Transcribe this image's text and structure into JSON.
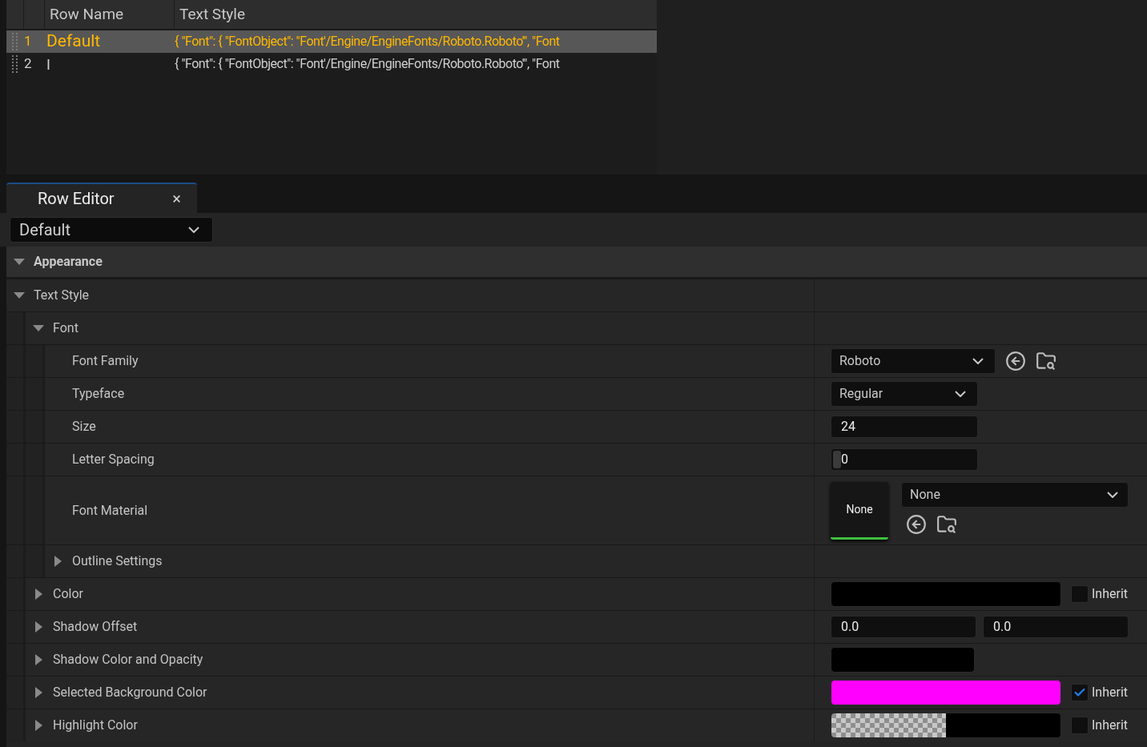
{
  "table": {
    "columns": [
      "Row Name",
      "Text Style"
    ],
    "rows": [
      {
        "index": "1",
        "name": "Default",
        "value": "{ \"Font\": { \"FontObject\": \"Font'/Engine/EngineFonts/Roboto.Roboto'\", \"Font",
        "selected": true
      },
      {
        "index": "2",
        "name": "I",
        "value": "{ \"Font\": { \"FontObject\": \"Font'/Engine/EngineFonts/Roboto.Roboto'\", \"Font",
        "selected": false
      }
    ]
  },
  "tab": {
    "label": "Row Editor",
    "close": "×"
  },
  "row_selector": {
    "value": "Default"
  },
  "category": {
    "label": "Appearance",
    "expanded": true
  },
  "properties": [
    {
      "label": "Text Style",
      "expanded": true,
      "children": [
        {
          "label": "Font",
          "expanded": true,
          "children": [
            {
              "label": "Font Family",
              "kind": "combo_browse",
              "value": "Roboto"
            },
            {
              "label": "Typeface",
              "kind": "combo",
              "value": "Regular"
            },
            {
              "label": "Size",
              "kind": "number",
              "value": "24"
            },
            {
              "label": "Letter Spacing",
              "kind": "number",
              "value": "0",
              "level": 0
            },
            {
              "label": "Font Material",
              "kind": "asset",
              "thumbnail": "None",
              "value": "None"
            },
            {
              "label": "Outline Settings",
              "expanded": false
            }
          ]
        },
        {
          "label": "Color",
          "kind": "color",
          "expanded": false,
          "color": "#000000",
          "inherit": {
            "label": "Inherit",
            "checked": false
          }
        },
        {
          "label": "Shadow Offset",
          "kind": "vector",
          "expanded": false,
          "values": [
            "0.0",
            "0.0"
          ]
        },
        {
          "label": "Shadow Color and Opacity",
          "kind": "color",
          "expanded": false,
          "color": "#000000"
        },
        {
          "label": "Selected Background Color",
          "kind": "color",
          "expanded": false,
          "color": "#ff00ff",
          "inherit": {
            "label": "Inherit",
            "checked": true
          }
        },
        {
          "label": "Highlight Color",
          "kind": "color_alpha",
          "expanded": false,
          "color": "#000000",
          "inherit": {
            "label": "Inherit",
            "checked": false
          }
        }
      ]
    }
  ]
}
